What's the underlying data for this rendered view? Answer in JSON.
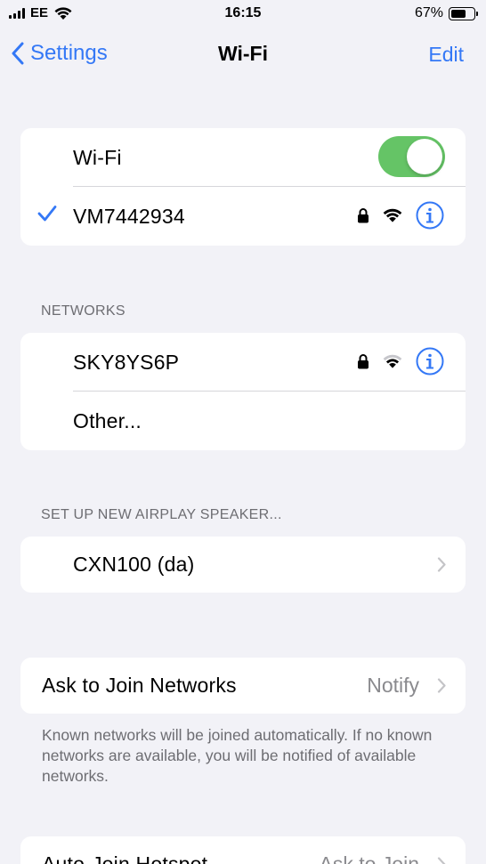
{
  "status_bar": {
    "carrier": "EE",
    "time": "16:15",
    "battery_percent": "67%",
    "battery_level": 0.67
  },
  "nav": {
    "back_label": "Settings",
    "title": "Wi-Fi",
    "edit_label": "Edit"
  },
  "wifi_group": {
    "toggle_label": "Wi-Fi",
    "toggle_on": true,
    "connected_network": "VM7442934"
  },
  "networks": {
    "header": "NETWORKS",
    "items": [
      {
        "name": "SKY8YS6P"
      },
      {
        "name": "Other..."
      }
    ]
  },
  "airplay": {
    "header": "SET UP NEW AIRPLAY SPEAKER...",
    "items": [
      {
        "name": "CXN100 (da)"
      }
    ]
  },
  "ask_to_join": {
    "label": "Ask to Join Networks",
    "value": "Notify",
    "note": "Known networks will be joined automatically. If no known networks are available, you will be notified of available networks."
  },
  "auto_join_hotspot": {
    "label": "Auto-Join Hotspot",
    "value": "Ask to Join"
  },
  "colors": {
    "accent": "#3478f6",
    "toggle_on": "#65c466",
    "background": "#f2f2f7"
  }
}
